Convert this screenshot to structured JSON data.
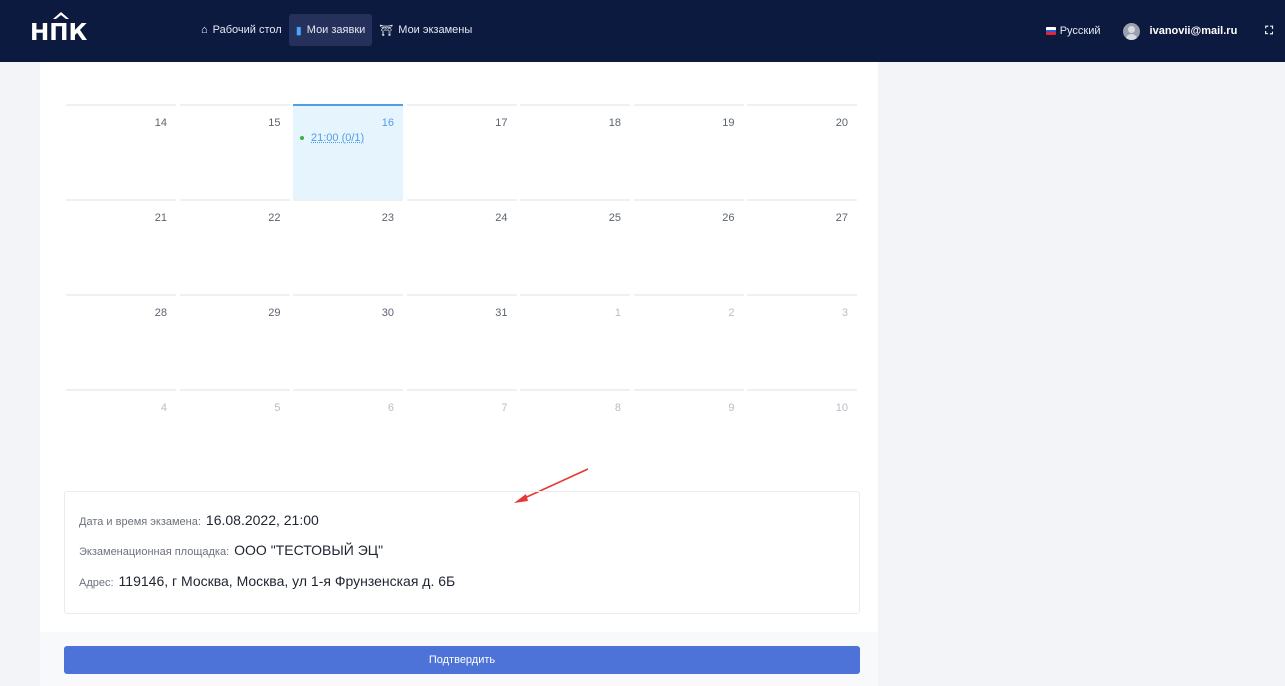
{
  "header": {
    "logo_text": "НПК",
    "nav": [
      {
        "label": "Рабочий стол",
        "icon": "home-icon"
      },
      {
        "label": "Мои заявки",
        "icon": "document-icon"
      },
      {
        "label": "Мои экзамены",
        "icon": "university-icon"
      }
    ],
    "language": "Русский",
    "user_email": "ivanovii@mail.ru"
  },
  "calendar": {
    "weeks": [
      [
        "14",
        "15",
        "16",
        "17",
        "18",
        "19",
        "20"
      ],
      [
        "21",
        "22",
        "23",
        "24",
        "25",
        "26",
        "27"
      ],
      [
        "28",
        "29",
        "30",
        "31",
        "1",
        "2",
        "3"
      ],
      [
        "4",
        "5",
        "6",
        "7",
        "8",
        "9",
        "10"
      ]
    ],
    "today": "16",
    "event": {
      "day": "16",
      "label": "21:00 (0/1)"
    }
  },
  "exam_info": {
    "datetime_label": "Дата и время экзамена:",
    "datetime_value": "16.08.2022, 21:00",
    "venue_label": "Экзаменационная площадка:",
    "venue_value": "ООО \"ТЕСТОВЫЙ ЭЦ\"",
    "address_label": "Адрес:",
    "address_value": "119146, г Москва, Москва, ул 1-я Фрунзенская д. 6Б"
  },
  "actions": {
    "confirm_label": "Подтвердить"
  },
  "colors": {
    "navbar": "#0d1a3f",
    "accent": "#4e73d8",
    "today_bg": "#e6f4fd",
    "event_dot": "#37b34a",
    "annotation_arrow": "#e53935"
  }
}
